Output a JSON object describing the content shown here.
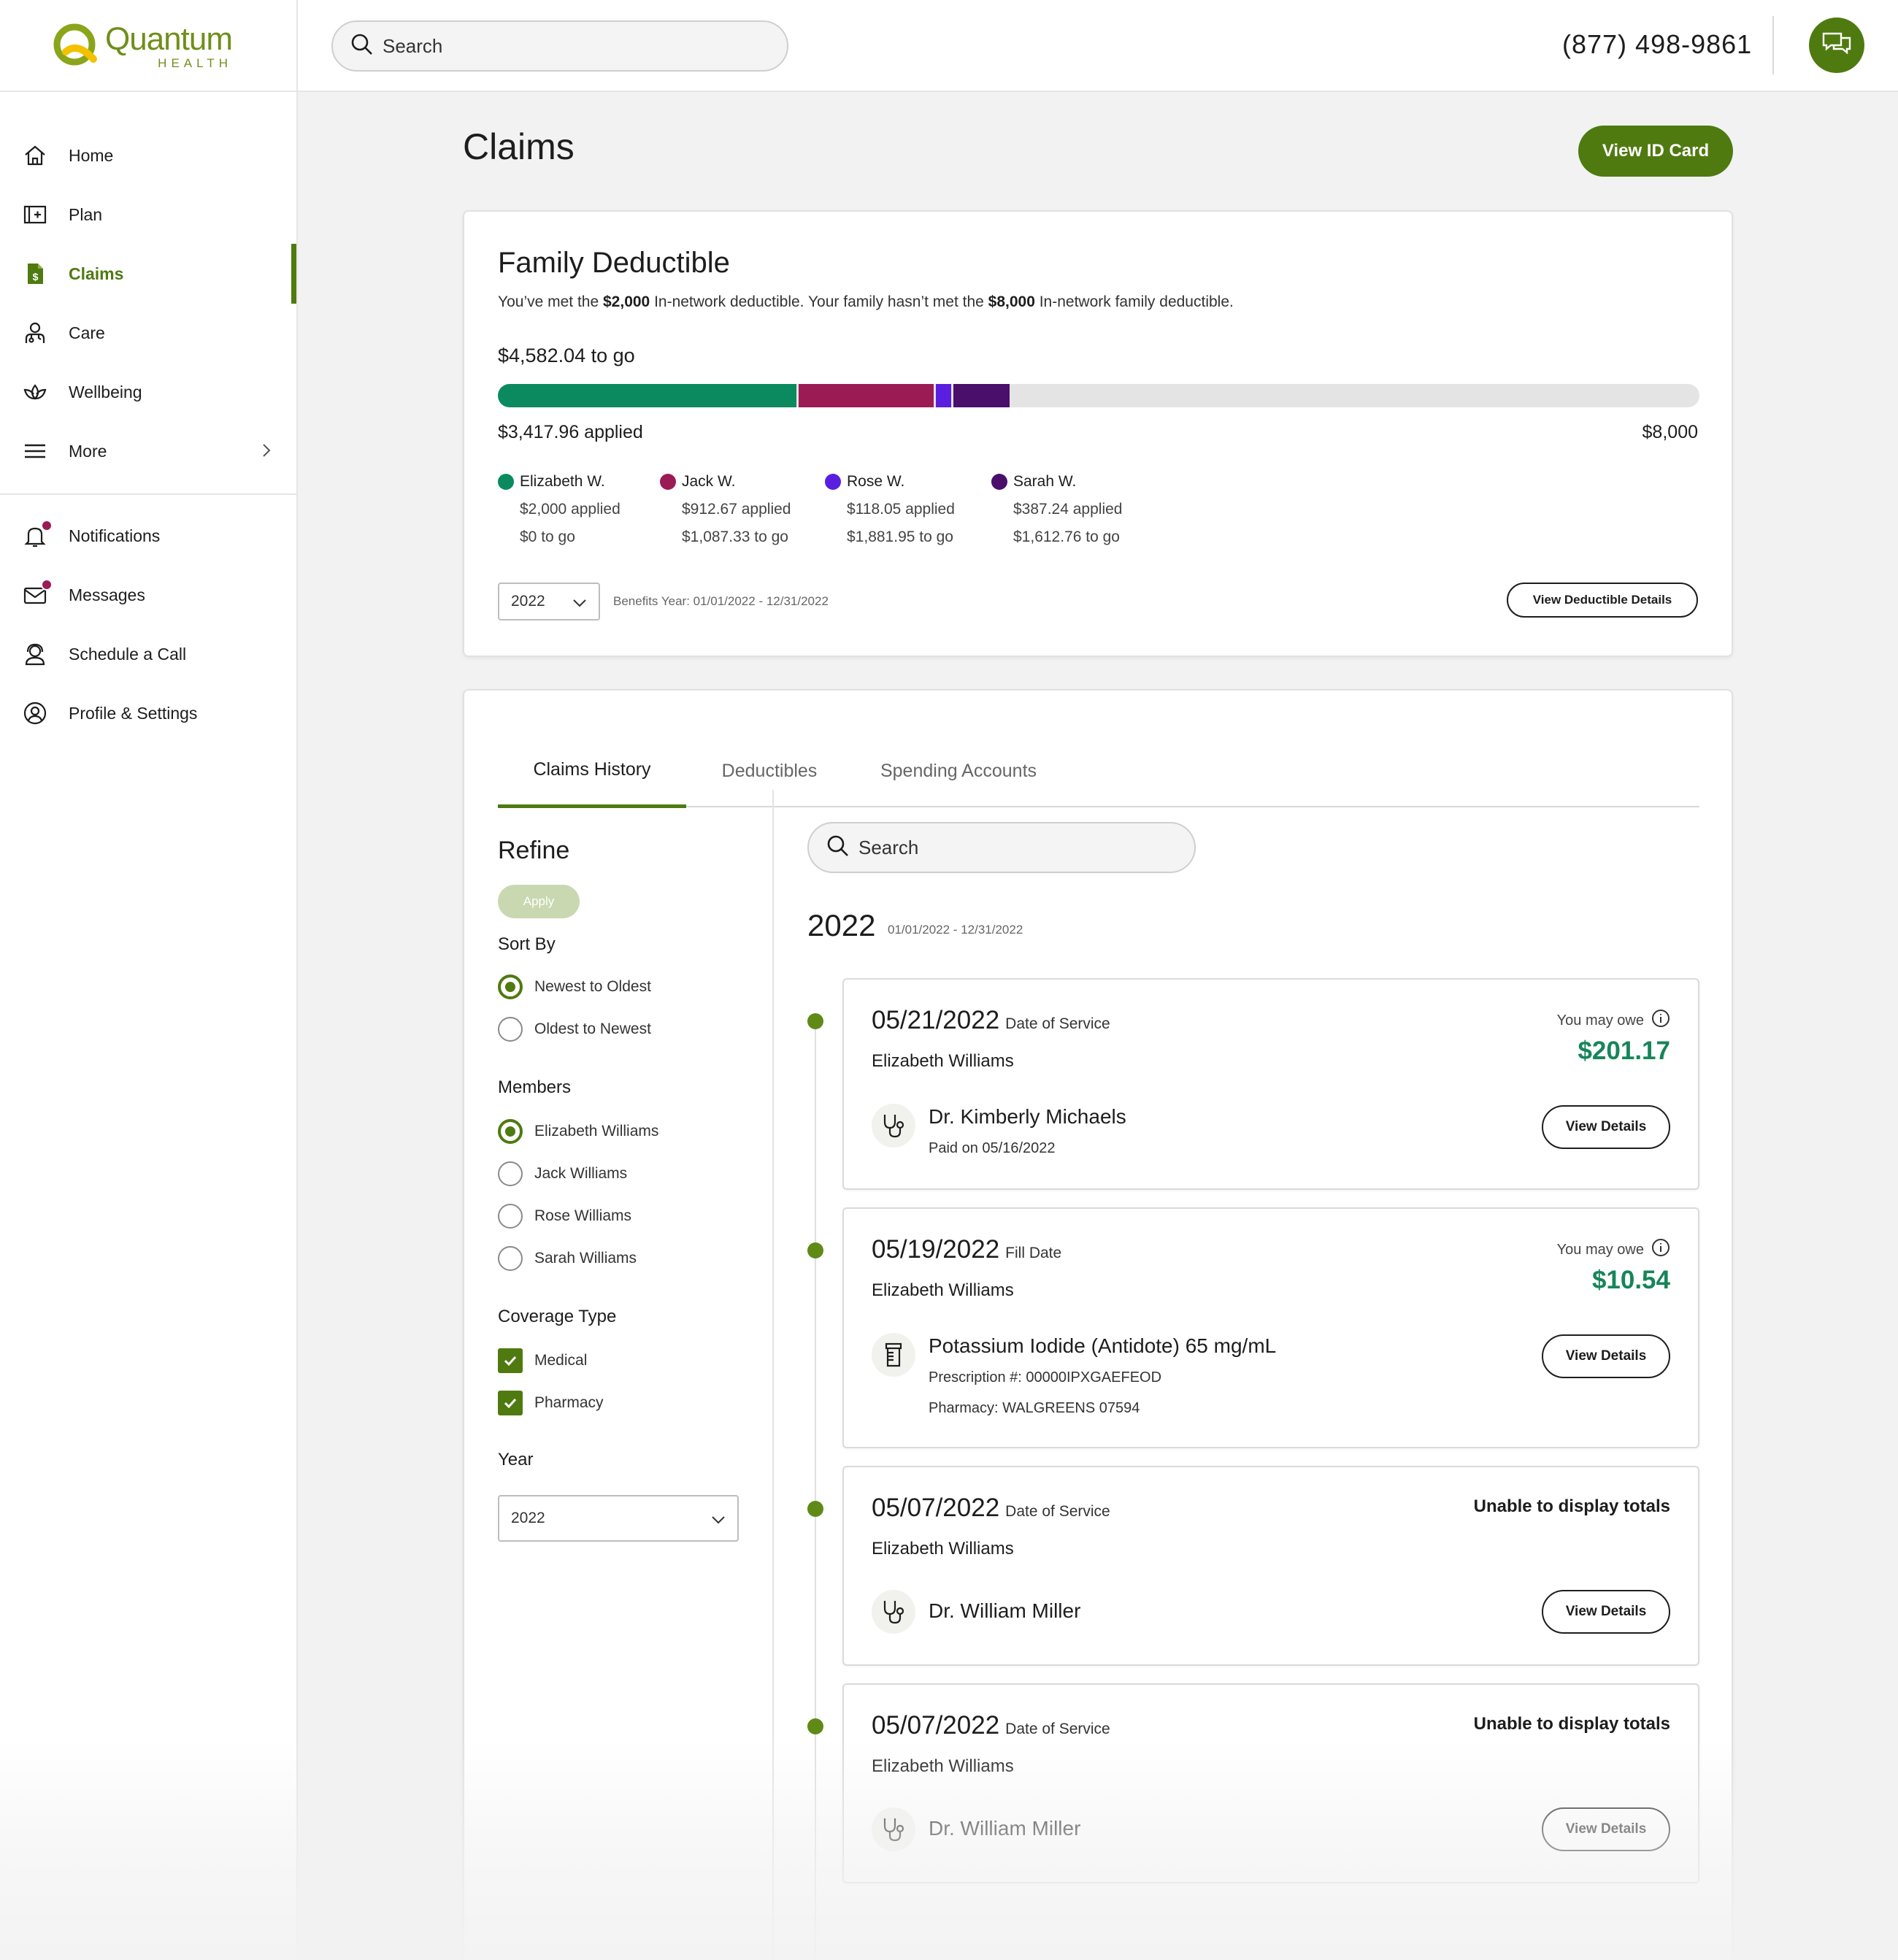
{
  "brand": {
    "name": "Quantum",
    "sub": "HEALTH"
  },
  "sidebar": {
    "items": [
      {
        "label": "Home",
        "icon": "home-icon"
      },
      {
        "label": "Plan",
        "icon": "plan-icon"
      },
      {
        "label": "Claims",
        "icon": "claims-icon",
        "active": true
      },
      {
        "label": "Care",
        "icon": "care-icon"
      },
      {
        "label": "Wellbeing",
        "icon": "wellbeing-icon"
      },
      {
        "label": "More",
        "icon": "menu-icon"
      }
    ],
    "secondary": [
      {
        "label": "Notifications",
        "icon": "bell-icon",
        "badge": true
      },
      {
        "label": "Messages",
        "icon": "mail-icon",
        "badge": true
      },
      {
        "label": "Schedule a Call",
        "icon": "headset-icon"
      },
      {
        "label": "Profile & Settings",
        "icon": "profile-icon"
      }
    ]
  },
  "topbar": {
    "search_placeholder": "Search",
    "phone": "(877) 498-9861"
  },
  "page": {
    "title": "Claims",
    "view_id_card": "View ID Card"
  },
  "deductible": {
    "title": "Family Deductible",
    "subtitle_a": "You’ve met the ",
    "subtitle_b": "$2,000",
    "subtitle_c": " In-network deductible. Your family hasn’t met the ",
    "subtitle_d": "$8,000",
    "subtitle_e": " In-network family deductible.",
    "to_go": "$4,582.04 to go",
    "applied": "$3,417.96 applied",
    "total": "$8,000",
    "total_value": 8000,
    "members": [
      {
        "name": "Elizabeth W.",
        "applied": "$2,000 applied",
        "to_go": "$0 to go",
        "value": 2000,
        "color": "#0b8a5f"
      },
      {
        "name": "Jack W.",
        "applied": "$912.67 applied",
        "to_go": "$1,087.33 to go",
        "value": 912.67,
        "color": "#9b1b55"
      },
      {
        "name": "Rose W.",
        "applied": "$118.05 applied",
        "to_go": "$1,881.95 to go",
        "value": 118.05,
        "color": "#5a1ee0"
      },
      {
        "name": "Sarah W.",
        "applied": "$387.24 applied",
        "to_go": "$1,612.76 to go",
        "value": 387.24,
        "color": "#4a0e6b"
      }
    ],
    "year": "2022",
    "benefits_year": "Benefits Year: 01/01/2022 - 12/31/2022",
    "details_button": "View Deductible Details"
  },
  "tabs": [
    "Claims History",
    "Deductibles",
    "Spending Accounts"
  ],
  "refine": {
    "title": "Refine",
    "apply": "Apply",
    "sort_by": "Sort By",
    "sort_options": [
      "Newest to Oldest",
      "Oldest to Newest"
    ],
    "members_title": "Members",
    "members": [
      "Elizabeth Williams",
      "Jack Williams",
      "Rose Williams",
      "Sarah Williams"
    ],
    "coverage_title": "Coverage Type",
    "coverage": [
      "Medical",
      "Pharmacy"
    ],
    "year_title": "Year",
    "year_value": "2022"
  },
  "claims": {
    "search_placeholder": "Search",
    "year": "2022",
    "range": "01/01/2022 - 12/31/2022",
    "owe_label": "You may owe",
    "view_details": "View Details",
    "unable": "Unable to display totals",
    "items": [
      {
        "date": "05/21/2022",
        "date_label": "Date of Service",
        "member": "Elizabeth Williams",
        "amount": "$201.17",
        "provider": "Dr. Kimberly Michaels",
        "sub1": "Paid on 05/16/2022"
      },
      {
        "date": "05/19/2022",
        "date_label": "Fill Date",
        "member": "Elizabeth Williams",
        "amount": "$10.54",
        "provider": "Potassium Iodide (Antidote) 65 mg/mL",
        "sub1": "Prescription #: 00000IPXGAEFEOD",
        "sub2": "Pharmacy: WALGREENS 07594"
      },
      {
        "date": "05/07/2022",
        "date_label": "Date of Service",
        "member": "Elizabeth Williams",
        "provider": "Dr. William Miller"
      },
      {
        "date": "05/07/2022",
        "date_label": "Date of Service",
        "member": "Elizabeth Williams",
        "provider": "Dr. William Miller"
      }
    ]
  },
  "colors": {
    "brand": "#4f7a10",
    "owe": "#17855a"
  }
}
